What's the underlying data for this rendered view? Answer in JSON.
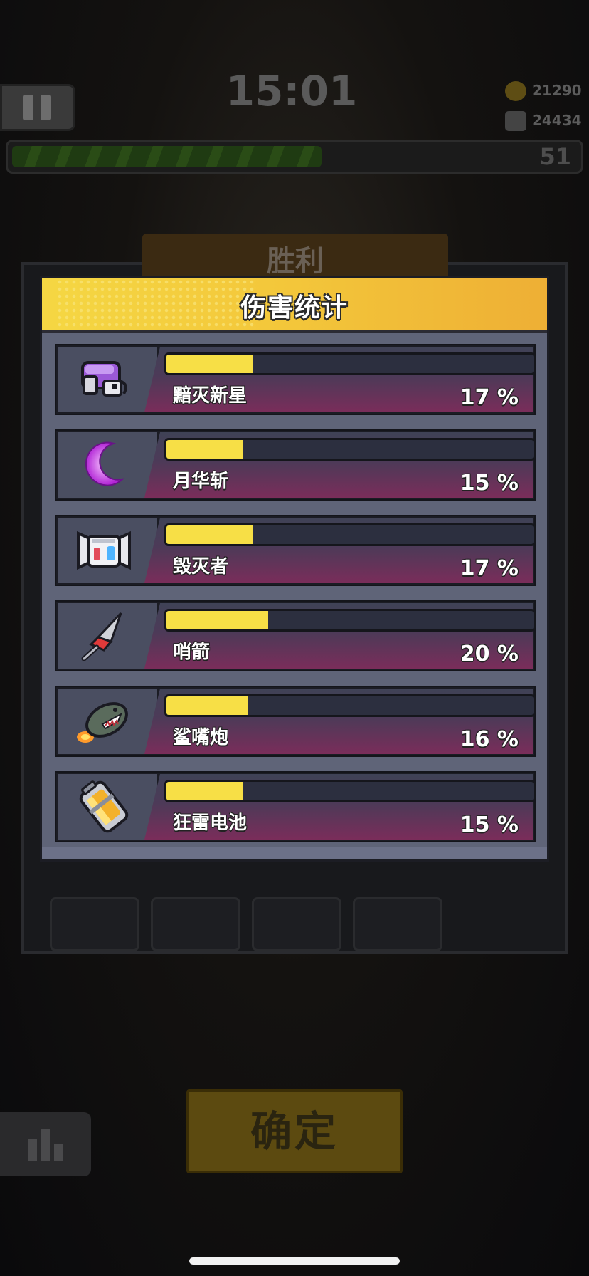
{
  "hud": {
    "timer": "15:01",
    "gold": "21290",
    "gems": "24434",
    "level": "51",
    "xp_progress": 0.54
  },
  "background": {
    "banner": "胜利",
    "confirm_label": "确定"
  },
  "modal": {
    "title": "伤害统计",
    "rows": [
      {
        "name": "黯灭新星",
        "percent": "17 %",
        "value": 0.17,
        "icon": "purple-cannon-icon"
      },
      {
        "name": "月华斩",
        "percent": "15 %",
        "value": 0.15,
        "icon": "crescent-moon-icon"
      },
      {
        "name": "毁灭者",
        "percent": "17 %",
        "value": 0.17,
        "icon": "robot-head-icon"
      },
      {
        "name": "哨箭",
        "percent": "20 %",
        "value": 0.2,
        "icon": "arrowhead-icon"
      },
      {
        "name": "鲨嘴炮",
        "percent": "16 %",
        "value": 0.16,
        "icon": "shark-rocket-icon"
      },
      {
        "name": "狂雷电池",
        "percent": "15 %",
        "value": 0.15,
        "icon": "battery-icon"
      }
    ]
  },
  "colors": {
    "header_yellow": "#f5d743",
    "bar_fill": "#f7df46",
    "panel": "#5f6478"
  }
}
